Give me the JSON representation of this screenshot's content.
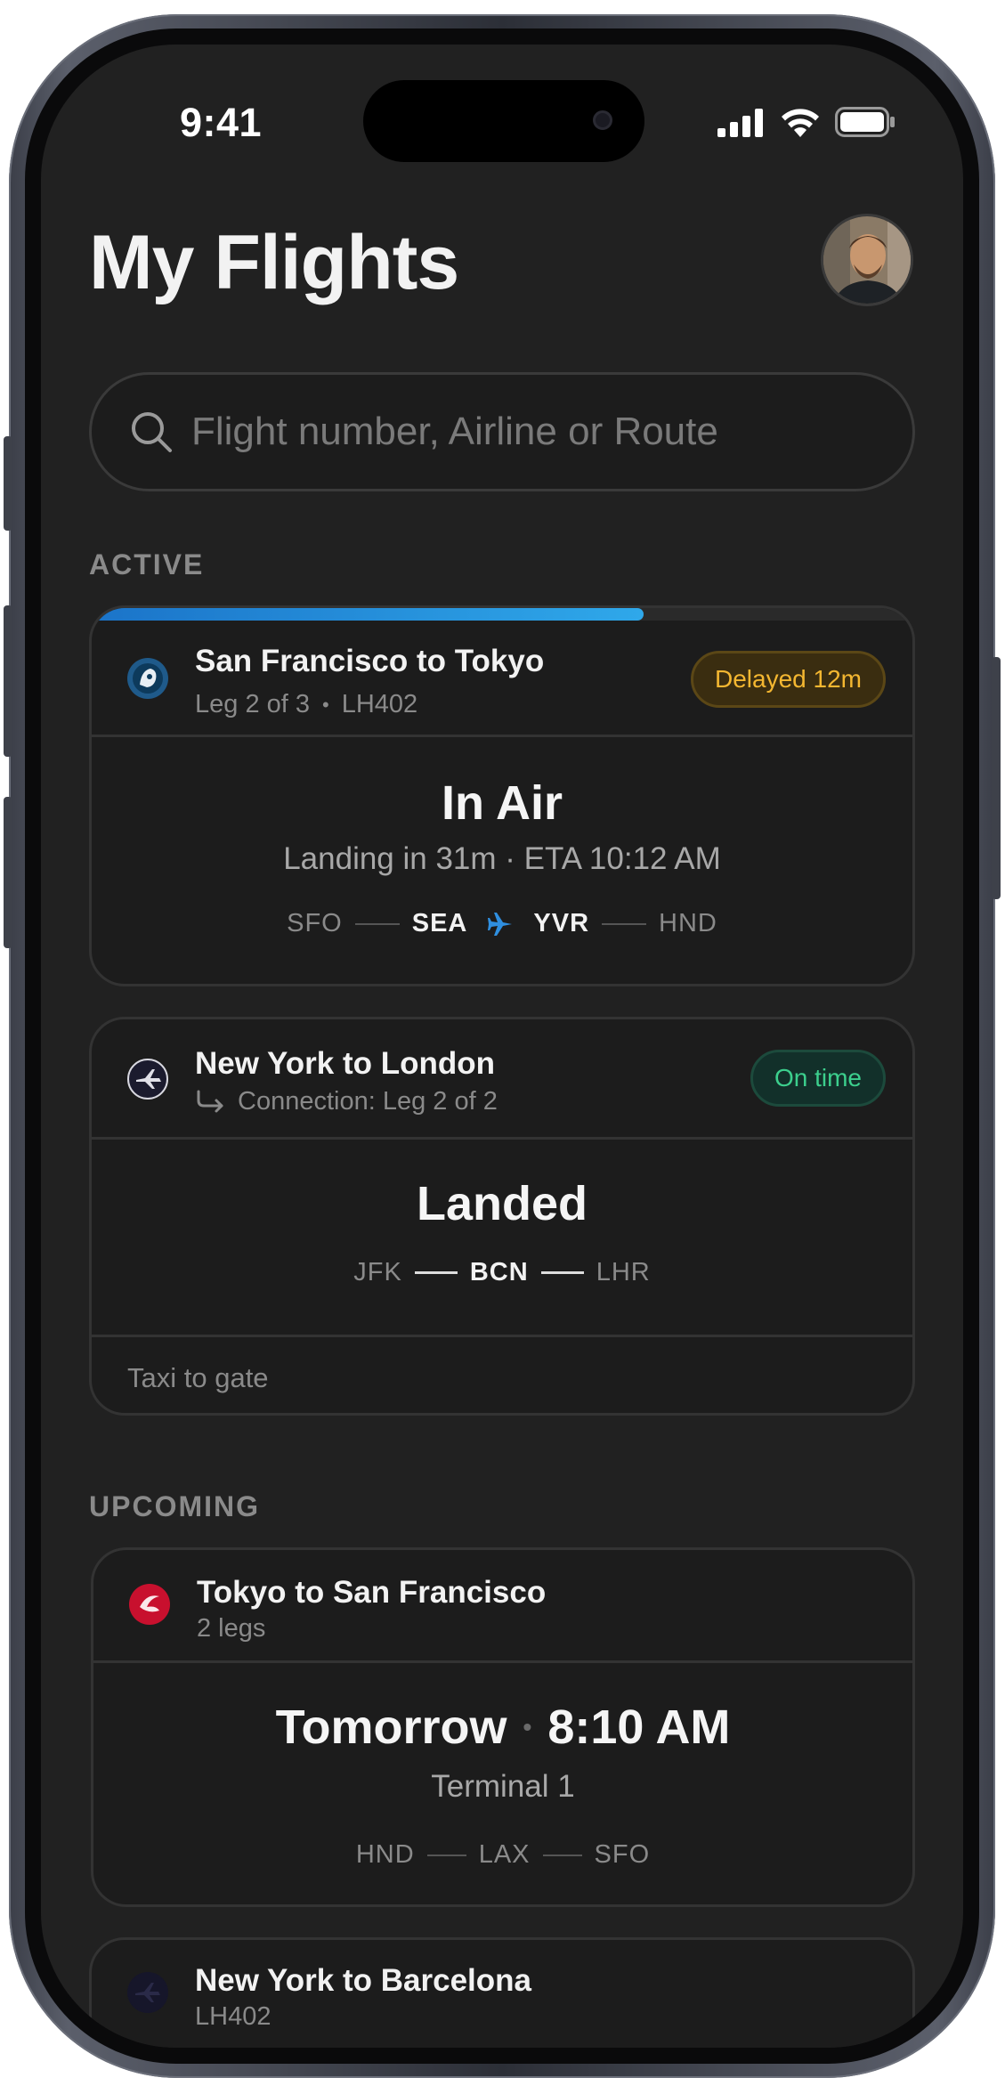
{
  "status_bar": {
    "time": "9:41"
  },
  "header": {
    "title": "My Flights"
  },
  "search": {
    "placeholder": "Flight number, Airline or Route"
  },
  "sections": {
    "active": "ACTIVE",
    "upcoming": "UPCOMING"
  },
  "active_flights": [
    {
      "route": "San Francisco to Tokyo",
      "leg": "Leg 2 of 3",
      "separator": "•",
      "flight_number": "LH402",
      "badge": "Delayed 12m",
      "status": "In Air",
      "eta_text": "Landing in 31m · ETA 10:12 AM",
      "progress": 0.67,
      "airports": [
        "SFO",
        "SEA",
        "YVR",
        "HND"
      ],
      "plane_icon": "plane-icon",
      "logo_color": "#1f5a8a"
    },
    {
      "route": "New York to London",
      "connection": "Connection: Leg 2 of 2",
      "badge": "On time",
      "status": "Landed",
      "airports": [
        "JFK",
        "BCN",
        "LHR"
      ],
      "footer": "Taxi to gate",
      "logo_color": "#1b1b2e"
    }
  ],
  "upcoming_flights": [
    {
      "route": "Tokyo to San Francisco",
      "legs": "2 legs",
      "day": "Tomorrow",
      "dot": "•",
      "time": "8:10 AM",
      "terminal": "Terminal 1",
      "airports": [
        "HND",
        "LAX",
        "SFO"
      ],
      "logo_color": "#c8102e"
    },
    {
      "route": "New York to Barcelona",
      "flight_number": "LH402",
      "logo_color": "#1b1b2e"
    }
  ],
  "colors": {
    "background": "#212121",
    "card": "#1c1c1c",
    "accent": "#2fa8ea",
    "delayed": "#f4b731",
    "on_time": "#3ccf8d"
  }
}
